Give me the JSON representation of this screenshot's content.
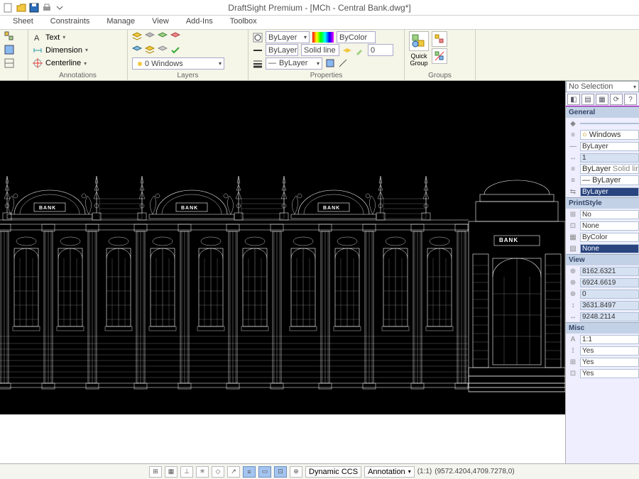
{
  "title": "DraftSight Premium - [MCh - Central Bank.dwg*]",
  "tabs": [
    "Sheet",
    "Constraints",
    "Manage",
    "View",
    "Add-Ins",
    "Toolbox"
  ],
  "panels": {
    "annotations": {
      "label": "Annotations",
      "text": "Text",
      "dimension": "Dimension",
      "centerline": "Centerline"
    },
    "layers": {
      "label": "Layers",
      "dropdown": "Windows",
      "layer_prefix": "0"
    },
    "properties": {
      "label": "Properties",
      "bylayer1": "ByLayer",
      "bylayer2": "ByLayer",
      "solidline": "Solid line",
      "bylayer3": "ByLayer",
      "bycolor": "ByColor",
      "zero": "0"
    },
    "groups": {
      "label": "Groups",
      "quickgroup": "Quick\nGroup"
    }
  },
  "props_palette": {
    "noselection": "No Selection",
    "sections": {
      "general": "General",
      "printstyle": "PrintStyle",
      "view": "View",
      "misc": "Misc"
    },
    "general": {
      "color": "",
      "layer": "Windows",
      "linestyle": "ByLayer",
      "scale": "1",
      "style2": "ByLayer",
      "style2b": "Solid line",
      "style3": "ByLayer",
      "weight": "ByLayer"
    },
    "printstyle": {
      "a": "No",
      "b": "None",
      "c": "ByColor",
      "d": "None"
    },
    "view": {
      "x": "8162.6321",
      "y": "6924.6619",
      "z": "0",
      "h": "3631.8497",
      "w": "9248.2114"
    },
    "misc": {
      "a": "1:1",
      "b": "Yes",
      "c": "Yes",
      "d": "Yes"
    }
  },
  "statusbar": {
    "dynamicccs": "Dynamic CCS",
    "annotation": "Annotation",
    "scale": "(1:1)",
    "coords": "(9572.4204,4709.7278,0)"
  },
  "drawing_text": {
    "bank": "BANK"
  }
}
